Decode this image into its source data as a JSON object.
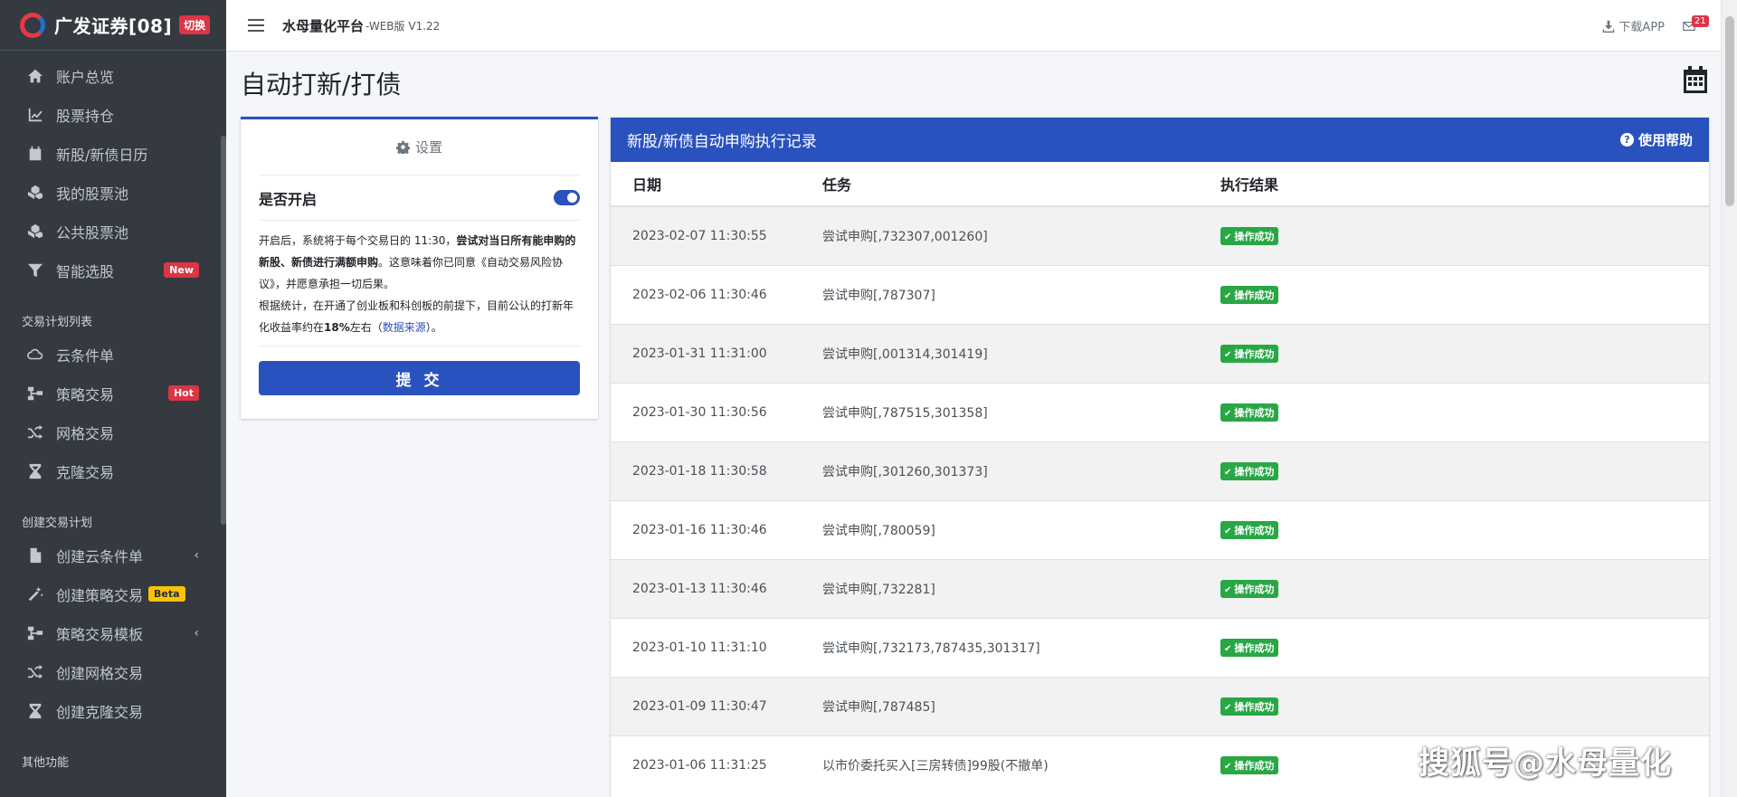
{
  "brand": {
    "title": "广发证券[08]",
    "switch_label": "切换"
  },
  "sidebar": {
    "items": [
      {
        "label": "账户总览",
        "icon": "home-icon"
      },
      {
        "label": "股票持仓",
        "icon": "chart-line-icon"
      },
      {
        "label": "新股/新债日历",
        "icon": "calendar-icon"
      },
      {
        "label": "我的股票池",
        "icon": "cubes-icon"
      },
      {
        "label": "公共股票池",
        "icon": "cubes-icon"
      },
      {
        "label": "智能选股",
        "icon": "filter-icon",
        "badge": "New"
      }
    ],
    "section1": "交易计划列表",
    "items2": [
      {
        "label": "云条件单",
        "icon": "cloud-icon"
      },
      {
        "label": "策略交易",
        "icon": "sitemap-icon",
        "badge": "Hot"
      },
      {
        "label": "网格交易",
        "icon": "random-icon"
      },
      {
        "label": "克隆交易",
        "icon": "hourglass-icon"
      }
    ],
    "section2": "创建交易计划",
    "items3": [
      {
        "label": "创建云条件单",
        "icon": "file-icon"
      },
      {
        "label": "创建策略交易",
        "icon": "magic-icon",
        "badge": "Beta"
      },
      {
        "label": "策略交易模板",
        "icon": "sitemap-icon"
      },
      {
        "label": "创建网格交易",
        "icon": "random-icon"
      },
      {
        "label": "创建克隆交易",
        "icon": "hourglass-icon"
      }
    ],
    "section3": "其他功能"
  },
  "topbar": {
    "title": "水母量化平台",
    "version": "-WEB版 V1.22",
    "download": "下载APP",
    "mail_count": "21"
  },
  "page": {
    "title": "自动打新/打债"
  },
  "settings": {
    "header": "设置",
    "toggle_label": "是否开启",
    "desc_1": "开启后，系统将于每个交易日的 11:30，",
    "desc_bold_1": "尝试对当日所有能申购的新股、新债进行满额申购",
    "desc_2": "。这意味着你已同意《自动交易风险协议》，并愿意承担一切后果。",
    "desc_3": "根据统计，在开通了创业板和科创板的前提下，目前公认的打新年化收益率约在",
    "desc_bold_2": "18%",
    "desc_4": "左右（",
    "desc_link": "数据来源",
    "desc_5": "）。",
    "submit_label": "提 交"
  },
  "records": {
    "title": "新股/新债自动申购执行记录",
    "help": "使用帮助",
    "columns": [
      "日期",
      "任务",
      "执行结果"
    ],
    "rows": [
      {
        "date": "2023-02-07 11:30:55",
        "task": "尝试申购[,732307,001260]",
        "result": "操作成功"
      },
      {
        "date": "2023-02-06 11:30:46",
        "task": "尝试申购[,787307]",
        "result": "操作成功"
      },
      {
        "date": "2023-01-31 11:31:00",
        "task": "尝试申购[,001314,301419]",
        "result": "操作成功"
      },
      {
        "date": "2023-01-30 11:30:56",
        "task": "尝试申购[,787515,301358]",
        "result": "操作成功"
      },
      {
        "date": "2023-01-18 11:30:58",
        "task": "尝试申购[,301260,301373]",
        "result": "操作成功"
      },
      {
        "date": "2023-01-16 11:30:46",
        "task": "尝试申购[,780059]",
        "result": "操作成功"
      },
      {
        "date": "2023-01-13 11:30:46",
        "task": "尝试申购[,732281]",
        "result": "操作成功"
      },
      {
        "date": "2023-01-10 11:31:10",
        "task": "尝试申购[,732173,787435,301317]",
        "result": "操作成功"
      },
      {
        "date": "2023-01-09 11:30:47",
        "task": "尝试申购[,787485]",
        "result": "操作成功"
      },
      {
        "date": "2023-01-06 11:31:25",
        "task": "以市价委托买入[三房转债]99股(不撤单)",
        "result": "操作成功"
      }
    ]
  },
  "watermark": "搜狐号@水母量化",
  "colors": {
    "primary": "#2a52be",
    "success": "#28a745",
    "sidebar": "#343a40",
    "danger": "#dc3545"
  }
}
